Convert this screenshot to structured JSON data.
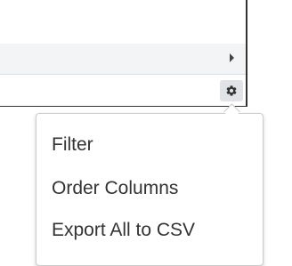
{
  "toolbar": {
    "settings_icon": "gear-icon",
    "scroll_icon": "caret-right-icon"
  },
  "menu": {
    "items": [
      {
        "label": "Filter"
      },
      {
        "label": "Order Columns"
      },
      {
        "label": "Export All to CSV"
      }
    ]
  }
}
